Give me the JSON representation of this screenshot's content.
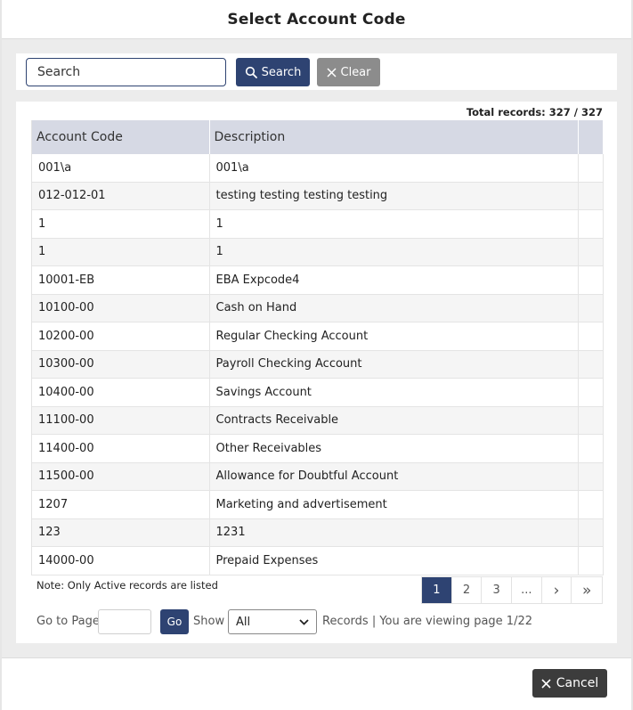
{
  "modal": {
    "title": "Select Account Code"
  },
  "search": {
    "placeholder": "Search",
    "search_label": "Search",
    "clear_label": "Clear"
  },
  "grid": {
    "total_records": "Total records: 327 / 327",
    "columns": [
      "Account Code",
      "Description"
    ],
    "rows": [
      {
        "code": "001\\a",
        "description": "001\\a"
      },
      {
        "code": "012-012-01",
        "description": "testing testing testing testing"
      },
      {
        "code": "1",
        "description": "1"
      },
      {
        "code": "1",
        "description": "1"
      },
      {
        "code": "10001-EB",
        "description": "EBA Expcode4"
      },
      {
        "code": "10100-00",
        "description": "Cash on Hand"
      },
      {
        "code": "10200-00",
        "description": "Regular Checking Account"
      },
      {
        "code": "10300-00",
        "description": "Payroll Checking Account"
      },
      {
        "code": "10400-00",
        "description": "Savings Account"
      },
      {
        "code": "11100-00",
        "description": "Contracts Receivable"
      },
      {
        "code": "11400-00",
        "description": "Other Receivables"
      },
      {
        "code": "11500-00",
        "description": "Allowance for Doubtful Account"
      },
      {
        "code": "1207",
        "description": "Marketing and advertisement"
      },
      {
        "code": "123",
        "description": "1231"
      },
      {
        "code": "14000-00",
        "description": "Prepaid Expenses"
      }
    ],
    "note": "Note: Only Active records are listed"
  },
  "pagination": {
    "pages": [
      "1",
      "2",
      "3",
      "..."
    ],
    "active_page": "1",
    "next_glyph": "›",
    "last_glyph": "»",
    "goto_label": "Go to Page",
    "go_label": "Go",
    "show_label": "Show",
    "page_size": "All",
    "records_info": "Records | You are viewing page 1/22"
  },
  "footer": {
    "cancel_label": "Cancel"
  },
  "icons": {
    "search": "search-icon",
    "clear": "close-icon",
    "cancel": "close-icon",
    "dropdown": "chevron-down-icon"
  },
  "colors": {
    "primary": "#2e4372",
    "header_bg": "#d6d9e4",
    "clear_bg": "#8c8c8c",
    "cancel_bg": "#3c3c3c"
  }
}
